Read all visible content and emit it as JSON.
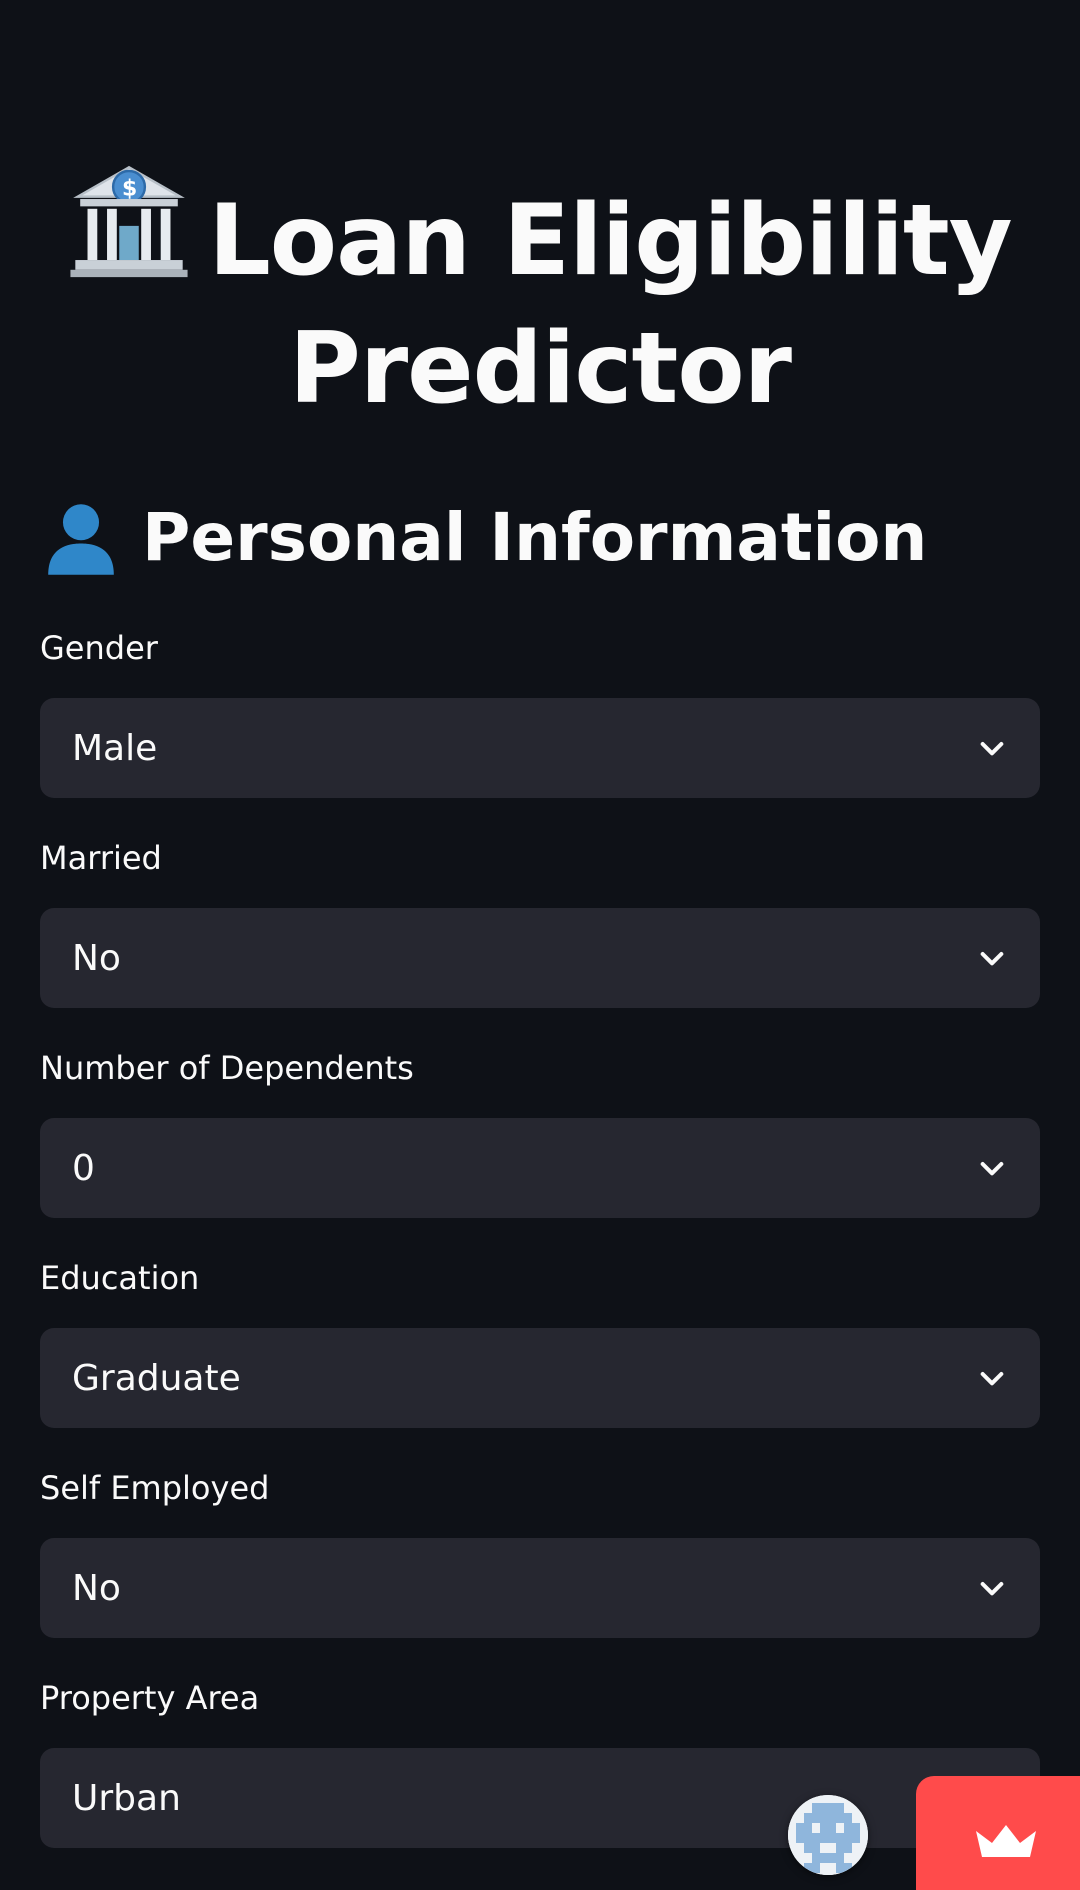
{
  "header": {
    "title": "Loan Eligibility Predictor",
    "title_icon": "bank-icon"
  },
  "section": {
    "title": "Personal Information",
    "icon": "person-icon"
  },
  "fields": {
    "gender": {
      "label": "Gender",
      "value": "Male"
    },
    "married": {
      "label": "Married",
      "value": "No"
    },
    "dependents": {
      "label": "Number of Dependents",
      "value": "0"
    },
    "education": {
      "label": "Education",
      "value": "Graduate"
    },
    "self_employed": {
      "label": "Self Employed",
      "value": "No"
    },
    "property_area": {
      "label": "Property Area",
      "value": "Urban"
    }
  },
  "colors": {
    "background": "#0e1117",
    "input_background": "#262730",
    "text": "#fafafa",
    "accent": "#ff4b4b"
  }
}
